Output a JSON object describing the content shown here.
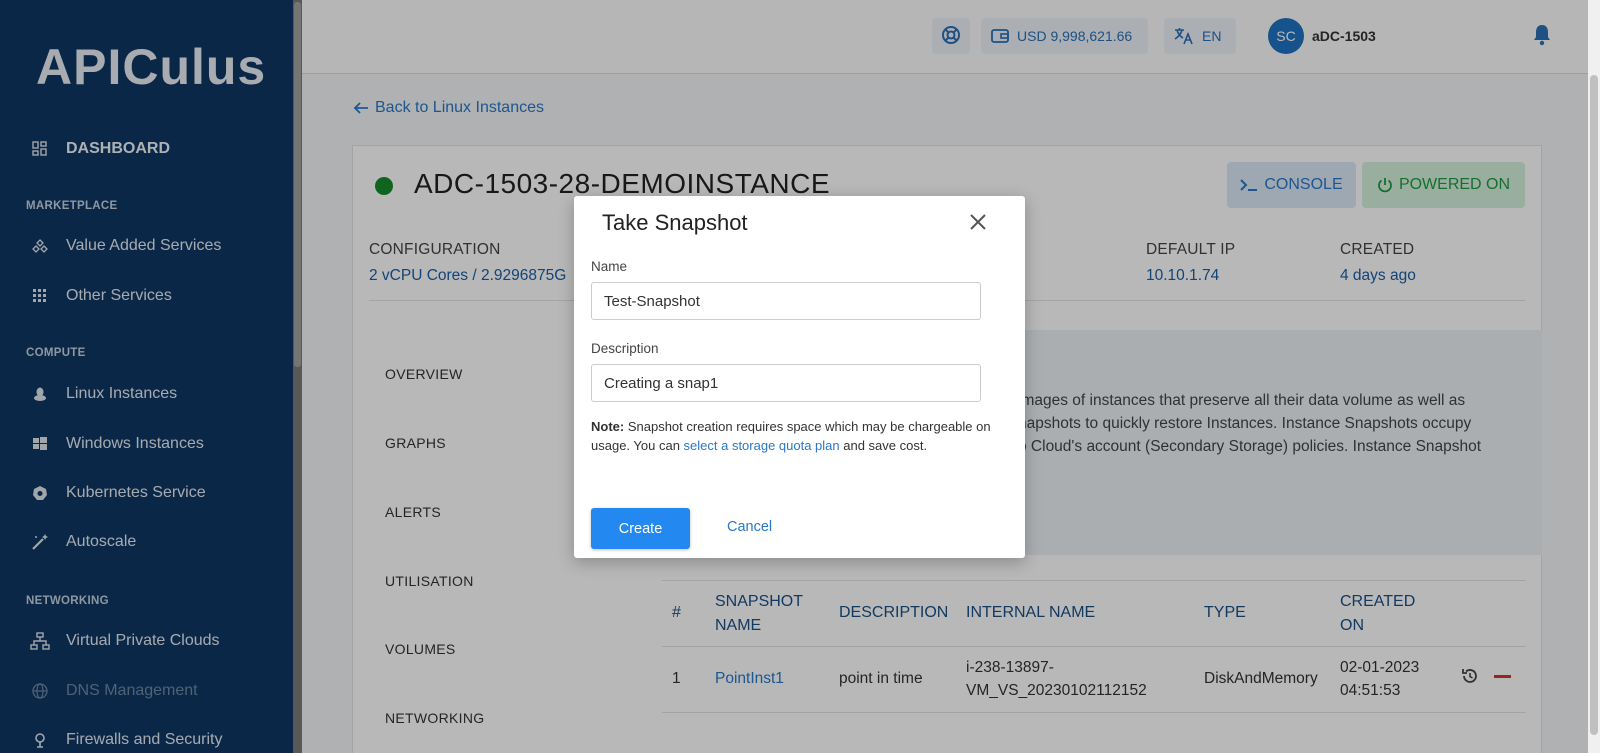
{
  "sidebar": {
    "logo": "APICulus",
    "dashboard": "DASHBOARD",
    "sections": {
      "marketplace": "MARKETPLACE",
      "compute": "COMPUTE",
      "networking": "NETWORKING"
    },
    "items": [
      {
        "label": "Value Added Services",
        "icon": "cubes-icon"
      },
      {
        "label": "Other Services",
        "icon": "grid-icon"
      },
      {
        "label": "Linux Instances",
        "icon": "linux-icon"
      },
      {
        "label": "Windows Instances",
        "icon": "windows-icon"
      },
      {
        "label": "Kubernetes Service",
        "icon": "kubernetes-icon"
      },
      {
        "label": "Autoscale",
        "icon": "magic-wand-icon"
      },
      {
        "label": "Virtual Private Clouds",
        "icon": "network-icon"
      },
      {
        "label": "DNS Management",
        "icon": "globe-icon"
      },
      {
        "label": "Firewalls and Security",
        "icon": "shield-icon"
      }
    ]
  },
  "topbar": {
    "balance": "USD 9,998,621.66",
    "language": "EN",
    "avatar_initials": "SC",
    "username": "aDC-1503"
  },
  "page": {
    "back_link": "Back to Linux Instances",
    "instance_name": "ADC-1503-28-DEMOINSTANCE",
    "console_label": "CONSOLE",
    "power_label": "POWERED ON",
    "configuration_label": "CONFIGURATION",
    "configuration_value": "2 vCPU Cores / 2.9296875G",
    "default_ip_label": "DEFAULT IP",
    "default_ip_value": "10.10.1.74",
    "created_label": "CREATED",
    "created_value": "4 days ago",
    "subnav": [
      "OVERVIEW",
      "GRAPHS",
      "ALERTS",
      "UTILISATION",
      "VOLUMES",
      "NETWORKING"
    ],
    "info_lines": [
      "images of instances that preserve all their data volume as well as",
      "napshots to quickly restore Instances. Instance Snapshots occupy",
      "o Cloud's account (Secondary Storage) policies. Instance Snapshot"
    ]
  },
  "table": {
    "headers": {
      "num": "#",
      "name_1": "SNAPSHOT",
      "name_2": "NAME",
      "description": "DESCRIPTION",
      "internal": "INTERNAL NAME",
      "type": "TYPE",
      "created_1": "CREATED",
      "created_2": "ON"
    },
    "rows": [
      {
        "num": "1",
        "name": "PointInst1",
        "description": "point in time",
        "internal_1": "i-238-13897-",
        "internal_2": "VM_VS_20230102112152",
        "type": "DiskAndMemory",
        "created_1": "02-01-2023",
        "created_2": "04:51:53"
      }
    ]
  },
  "modal": {
    "title": "Take Snapshot",
    "name_label": "Name",
    "name_value": "Test-Snapshot",
    "description_label": "Description",
    "description_value": "Creating a snap1",
    "note_bold": "Note:",
    "note_text_1": " Snapshot creation requires space which may be chargeable on usage. You can ",
    "note_link": "select a storage quota plan",
    "note_text_2": " and save cost.",
    "create_label": "Create",
    "cancel_label": "Cancel"
  },
  "colors": {
    "sidebar_bg": "#0f3763",
    "accent": "#2389f0",
    "status_green": "#168c2c"
  }
}
